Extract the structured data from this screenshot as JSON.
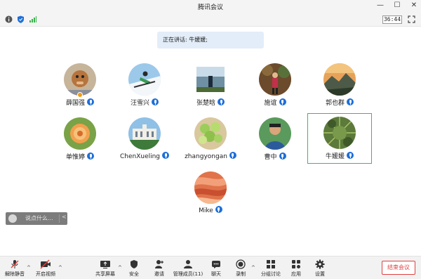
{
  "window": {
    "title": "腾讯会议"
  },
  "status": {
    "timer": "36:44"
  },
  "speaking": {
    "text": "正在讲话: 牛媛媛;"
  },
  "participants": [
    {
      "name": "薛国强",
      "mic": "on",
      "host": true
    },
    {
      "name": "汪雪兴",
      "mic": "on"
    },
    {
      "name": "张楚晗",
      "mic": "on"
    },
    {
      "name": "施谊",
      "mic": "on"
    },
    {
      "name": "郭也群",
      "mic": "on"
    },
    {
      "name": "单惟婷",
      "mic": "on"
    },
    {
      "name": "ChenXueling",
      "mic": "on"
    },
    {
      "name": "zhangyongan",
      "mic": "on"
    },
    {
      "name": "曹中",
      "mic": "on"
    },
    {
      "name": "牛媛媛",
      "mic": "on",
      "speaking": true
    },
    {
      "name": "Mike",
      "mic": "on"
    }
  ],
  "chat": {
    "placeholder": "说点什么..."
  },
  "toolbar": {
    "mute": "解除静音",
    "video": "开启视频",
    "share": "共享屏幕",
    "security": "安全",
    "invite": "邀请",
    "members": "管理成员(11)",
    "chat": "聊天",
    "record": "录制",
    "breakout": "分组讨论",
    "apps": "应用",
    "settings": "设置",
    "end": "结束会议"
  }
}
